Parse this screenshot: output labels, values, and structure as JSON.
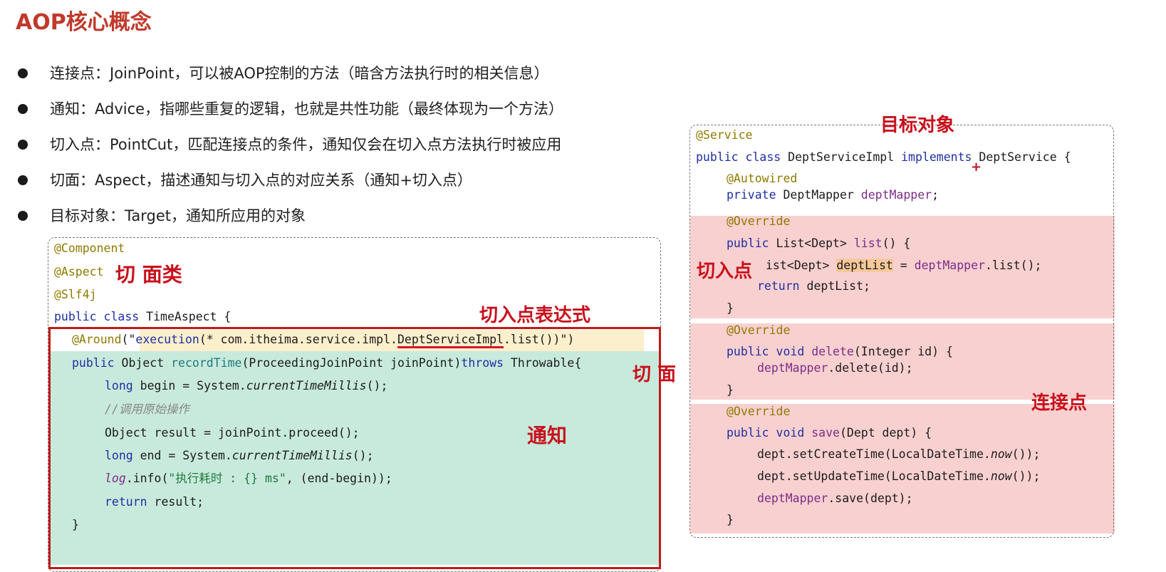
{
  "title": "AOP核心概念",
  "bullets": [
    "连接点：JoinPoint，可以被AOP控制的方法（暗含方法执行时的相关信息）",
    "通知：Advice，指哪些重复的逻辑，也就是共性功能（最终体现为一个方法）",
    "切入点：PointCut，匹配连接点的条件，通知仅会在切入点方法执行时被应用",
    "切面：Aspect，描述通知与切入点的对应关系（通知+切入点）",
    "目标对象：Target，通知所应用的对象"
  ],
  "aspect_code": {
    "l1": "@Component",
    "l2": "@Aspect",
    "l3": "@Slf4j",
    "l4_kw": "public class",
    "l4_rest": " TimeAspect {",
    "l5_ann": "@Around",
    "l5_a": "(\"",
    "l5_exec": "execution",
    "l5_b": "(* com.itheima.service.impl.",
    "l5_target": "DeptServiceImpl",
    "l5_c": ".list())",
    "l5_d": "\")",
    "l6_kw": "public",
    "l6_a": " Object ",
    "l6_m": "recordTime",
    "l6_b": "(ProceedingJoinPoint joinPoint)",
    "l6_kw2": "throws",
    "l6_c": " Throwable{",
    "l7_kw": "long",
    "l7_a": " begin = System.",
    "l7_m": "currentTimeMillis",
    "l7_b": "();",
    "l8": "//调用原始操作",
    "l9": "Object result = joinPoint.proceed();",
    "l10_kw": "long",
    "l10_a": " end = System.",
    "l10_m": "currentTimeMillis",
    "l10_b": "();",
    "l11_log": "log",
    "l11_a": ".info(",
    "l11_str": "\"执行耗时 : {} ms\"",
    "l11_b": ", (end-begin));",
    "l12_kw": "return",
    "l12_a": " result;",
    "l13": "}"
  },
  "target_code": {
    "r1": "@Service",
    "r2_kw": "public class",
    "r2_a": " DeptServiceImpl ",
    "r2_kw2": "implements",
    "r2_b": " DeptService {",
    "r3": "@Autowired",
    "r4_kw": "private",
    "r4_a": " DeptMapper ",
    "r4_f": "deptMapper",
    "r4_b": ";",
    "r5": "@Override",
    "r6_kw": "public",
    "r6_a": " List<Dept> ",
    "r6_m": "list",
    "r6_b": "() {",
    "r7_a": "ist<Dept> ",
    "r7_hl": "deptList",
    "r7_b": " = ",
    "r7_f": "deptMapper",
    "r7_c": ".list();",
    "r8_kw": "return",
    "r8_a": " deptList;",
    "r9": "}",
    "r10": "@Override",
    "r11_kw": "public void",
    "r11_m": " delete",
    "r11_a": "(Integer id) {",
    "r12_f": "deptMapper",
    "r12_a": ".delete(id);",
    "r13": "}",
    "r14": "@Override",
    "r15_kw": "public void",
    "r15_m": " save",
    "r15_a": "(Dept dept) {",
    "r16_a": "dept.setCreateTime(LocalDateTime.",
    "r16_i": "now",
    "r16_b": "());",
    "r17_a": "dept.setUpdateTime(LocalDateTime.",
    "r17_i": "now",
    "r17_b": "());",
    "r18_f": "deptMapper",
    "r18_a": ".save(dept);",
    "r19": "}"
  },
  "annotations": {
    "aspect_class": "切 面类",
    "pointcut_expr": "切入点表达式",
    "aspect": "切 面",
    "advice": "通知",
    "target_object": "目标对象",
    "pointcut": "切入点",
    "joinpoint": "连接点",
    "plus": "+"
  },
  "colors": {
    "title": "#c0392b",
    "annotation": "#c8101b",
    "advice_bg": "#c8eadd",
    "pointcut_bg": "#fbefcc",
    "joinpoint_bg": "#f9d0d0"
  }
}
